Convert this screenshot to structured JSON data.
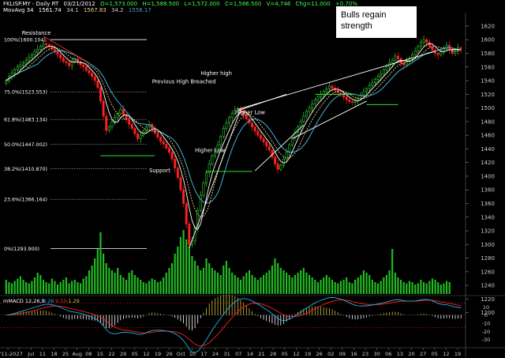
{
  "header": {
    "line1": {
      "symbol": "FKLISP.MY - Daily RT",
      "date": "03/21/2012",
      "open": "O=1,573.000",
      "high": "H=1,588.500",
      "low": "L=1,572.000",
      "close": "C=1,586.500",
      "volume": "V=4,746",
      "chg": "Chg=11.000",
      "pct": "+0.70%"
    },
    "line2": {
      "name": "MovAvg 34",
      "values": [
        "1561.74",
        "34.1",
        "1567.83",
        "34.2",
        "1556.17"
      ]
    }
  },
  "note_box": {
    "line1": "Bulls regain",
    "line2": "strength"
  },
  "colors": {
    "up": "#33cc33",
    "down": "#ff2020",
    "volume": "#22bb22",
    "ma_fast": "#ffffff",
    "ma_mid": "#e8d28a",
    "ma_slow": "#3fa3c3",
    "macd": "#20b0e0",
    "signal": "#ff2020",
    "hist_pos": "#d0c040",
    "hist_neg": "#ffffff"
  },
  "chart_data": {
    "type": "candlestick",
    "ylim": [
      1195,
      1635
    ],
    "yticks": [
      1200,
      1220,
      1240,
      1260,
      1280,
      1300,
      1320,
      1340,
      1360,
      1380,
      1400,
      1420,
      1440,
      1460,
      1480,
      1500,
      1520,
      1540,
      1560,
      1580,
      1600,
      1620
    ],
    "xticks": [
      "'11-20",
      "27",
      "Jul",
      "11",
      "18",
      "25",
      "Aug",
      "08",
      "15",
      "22",
      "29",
      "05",
      "12",
      "19",
      "26",
      "Oct",
      "10",
      "17",
      "24",
      "31",
      "07",
      "14",
      "21",
      "28",
      "05",
      "12",
      "19",
      "26",
      "02",
      "09",
      "16",
      "23",
      "30",
      "06",
      "13",
      "20",
      "27",
      "05",
      "12",
      "19"
    ],
    "fib_levels": [
      {
        "label": "100%(1600.104)",
        "value": 1600.104
      },
      {
        "label": "75.0%(1523.553)",
        "value": 1523.553
      },
      {
        "label": "61.8%(1483.134)",
        "value": 1483.134
      },
      {
        "label": "50.0%(1447.002)",
        "value": 1447.002
      },
      {
        "label": "38.2%(1410.870)",
        "value": 1410.87
      },
      {
        "label": "23.6%(1366.164)",
        "value": 1366.164
      },
      {
        "label": "0%(1293.900)",
        "value": 1293.9
      }
    ],
    "annotations": [
      {
        "text": "Resistance",
        "x": 5.5,
        "y": 1607
      },
      {
        "text": "Previous High Breached",
        "x": 51,
        "y": 1536
      },
      {
        "text": "Higher high",
        "x": 68,
        "y": 1548
      },
      {
        "text": "Support",
        "x": 50,
        "y": 1406
      },
      {
        "text": "Higher Low",
        "x": 66,
        "y": 1435
      },
      {
        "text": "Higher Low",
        "x": 80,
        "y": 1491
      }
    ],
    "ma_legend": "MovAvg 34",
    "macd": {
      "label": "mMACD 12,26,9",
      "values": [
        "8.26",
        "9.55",
        "-1.29"
      ],
      "ylim": [
        -38,
        20
      ],
      "yticks": [
        10,
        0,
        -10,
        -20,
        -30
      ],
      "ref_lines": [
        15,
        -15
      ]
    },
    "volume_ylim": [
      0,
      60
    ],
    "closes": [
      1540,
      1546,
      1551,
      1556,
      1560,
      1563,
      1566,
      1570,
      1574,
      1578,
      1582,
      1586,
      1590,
      1594,
      1593,
      1590,
      1586,
      1582,
      1578,
      1573,
      1568,
      1566,
      1562,
      1568,
      1572,
      1567,
      1563,
      1560,
      1555,
      1551,
      1546,
      1540,
      1530,
      1510,
      1488,
      1467,
      1472,
      1480,
      1486,
      1492,
      1498,
      1490,
      1483,
      1476,
      1470,
      1462,
      1455,
      1460,
      1466,
      1472,
      1476,
      1470,
      1463,
      1457,
      1451,
      1447,
      1441,
      1435,
      1425,
      1412,
      1398,
      1380,
      1360,
      1330,
      1300,
      1305,
      1325,
      1350,
      1372,
      1390,
      1405,
      1418,
      1430,
      1438,
      1446,
      1458,
      1470,
      1478,
      1486,
      1492,
      1497,
      1499,
      1495,
      1490,
      1484,
      1478,
      1472,
      1466,
      1460,
      1455,
      1450,
      1444,
      1438,
      1428,
      1418,
      1410,
      1416,
      1425,
      1435,
      1446,
      1456,
      1464,
      1472,
      1480,
      1488,
      1495,
      1500,
      1506,
      1512,
      1516,
      1520,
      1524,
      1528,
      1532,
      1529,
      1526,
      1522,
      1520,
      1516,
      1512,
      1509,
      1508,
      1510,
      1514,
      1519,
      1524,
      1528,
      1533,
      1537,
      1542,
      1546,
      1550,
      1556,
      1560,
      1566,
      1570,
      1576,
      1572,
      1566,
      1563,
      1568,
      1573,
      1578,
      1583,
      1590,
      1596,
      1600,
      1596,
      1590,
      1585,
      1580,
      1578,
      1582,
      1588,
      1592,
      1586,
      1580,
      1583,
      1588,
      1586.5
    ],
    "volumes": [
      12,
      10,
      9,
      11,
      13,
      15,
      12,
      10,
      9,
      11,
      14,
      18,
      16,
      12,
      10,
      9,
      13,
      11,
      8,
      10,
      12,
      14,
      9,
      11,
      12,
      10,
      9,
      13,
      15,
      20,
      24,
      30,
      38,
      52,
      34,
      26,
      22,
      20,
      18,
      22,
      16,
      14,
      12,
      18,
      20,
      16,
      14,
      12,
      10,
      9,
      11,
      13,
      12,
      10,
      11,
      14,
      18,
      22,
      26,
      34,
      40,
      48,
      54,
      46,
      40,
      32,
      28,
      24,
      20,
      22,
      30,
      26,
      22,
      20,
      18,
      16,
      24,
      28,
      22,
      18,
      16,
      14,
      12,
      15,
      18,
      20,
      16,
      14,
      12,
      14,
      16,
      18,
      20,
      24,
      30,
      26,
      22,
      20,
      18,
      16,
      14,
      16,
      18,
      20,
      22,
      18,
      16,
      14,
      12,
      10,
      12,
      14,
      16,
      14,
      12,
      10,
      9,
      11,
      12,
      14,
      10,
      9,
      12,
      14,
      16,
      20,
      18,
      16,
      12,
      10,
      9,
      11,
      14,
      16,
      20,
      38,
      18,
      14,
      12,
      10,
      9,
      11,
      10,
      8,
      9,
      12,
      10,
      9,
      11,
      13,
      12,
      10,
      8,
      9,
      11,
      10
    ]
  }
}
